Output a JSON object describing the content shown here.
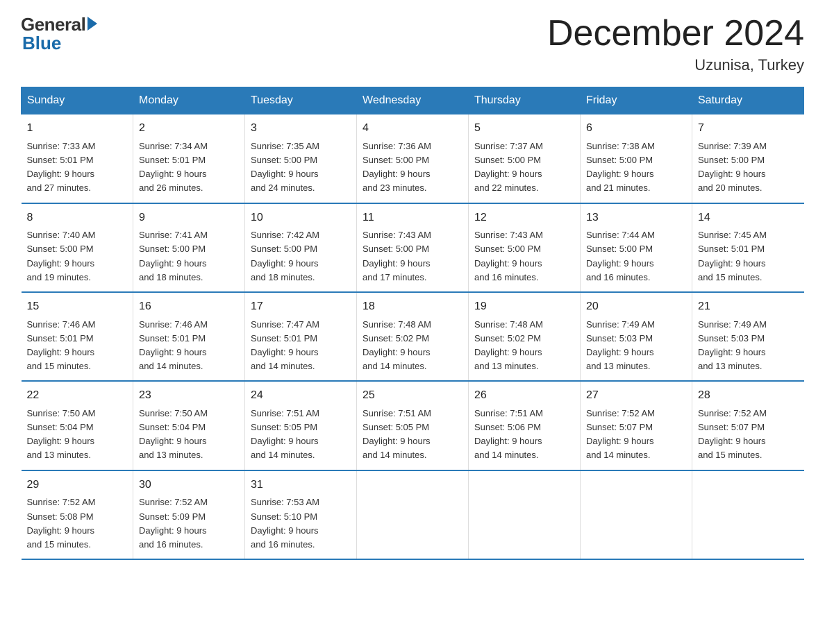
{
  "header": {
    "logo_general": "General",
    "logo_blue": "Blue",
    "title": "December 2024",
    "location": "Uzunisa, Turkey"
  },
  "days_of_week": [
    "Sunday",
    "Monday",
    "Tuesday",
    "Wednesday",
    "Thursday",
    "Friday",
    "Saturday"
  ],
  "weeks": [
    [
      {
        "day": "1",
        "info": "Sunrise: 7:33 AM\nSunset: 5:01 PM\nDaylight: 9 hours\nand 27 minutes."
      },
      {
        "day": "2",
        "info": "Sunrise: 7:34 AM\nSunset: 5:01 PM\nDaylight: 9 hours\nand 26 minutes."
      },
      {
        "day": "3",
        "info": "Sunrise: 7:35 AM\nSunset: 5:00 PM\nDaylight: 9 hours\nand 24 minutes."
      },
      {
        "day": "4",
        "info": "Sunrise: 7:36 AM\nSunset: 5:00 PM\nDaylight: 9 hours\nand 23 minutes."
      },
      {
        "day": "5",
        "info": "Sunrise: 7:37 AM\nSunset: 5:00 PM\nDaylight: 9 hours\nand 22 minutes."
      },
      {
        "day": "6",
        "info": "Sunrise: 7:38 AM\nSunset: 5:00 PM\nDaylight: 9 hours\nand 21 minutes."
      },
      {
        "day": "7",
        "info": "Sunrise: 7:39 AM\nSunset: 5:00 PM\nDaylight: 9 hours\nand 20 minutes."
      }
    ],
    [
      {
        "day": "8",
        "info": "Sunrise: 7:40 AM\nSunset: 5:00 PM\nDaylight: 9 hours\nand 19 minutes."
      },
      {
        "day": "9",
        "info": "Sunrise: 7:41 AM\nSunset: 5:00 PM\nDaylight: 9 hours\nand 18 minutes."
      },
      {
        "day": "10",
        "info": "Sunrise: 7:42 AM\nSunset: 5:00 PM\nDaylight: 9 hours\nand 18 minutes."
      },
      {
        "day": "11",
        "info": "Sunrise: 7:43 AM\nSunset: 5:00 PM\nDaylight: 9 hours\nand 17 minutes."
      },
      {
        "day": "12",
        "info": "Sunrise: 7:43 AM\nSunset: 5:00 PM\nDaylight: 9 hours\nand 16 minutes."
      },
      {
        "day": "13",
        "info": "Sunrise: 7:44 AM\nSunset: 5:00 PM\nDaylight: 9 hours\nand 16 minutes."
      },
      {
        "day": "14",
        "info": "Sunrise: 7:45 AM\nSunset: 5:01 PM\nDaylight: 9 hours\nand 15 minutes."
      }
    ],
    [
      {
        "day": "15",
        "info": "Sunrise: 7:46 AM\nSunset: 5:01 PM\nDaylight: 9 hours\nand 15 minutes."
      },
      {
        "day": "16",
        "info": "Sunrise: 7:46 AM\nSunset: 5:01 PM\nDaylight: 9 hours\nand 14 minutes."
      },
      {
        "day": "17",
        "info": "Sunrise: 7:47 AM\nSunset: 5:01 PM\nDaylight: 9 hours\nand 14 minutes."
      },
      {
        "day": "18",
        "info": "Sunrise: 7:48 AM\nSunset: 5:02 PM\nDaylight: 9 hours\nand 14 minutes."
      },
      {
        "day": "19",
        "info": "Sunrise: 7:48 AM\nSunset: 5:02 PM\nDaylight: 9 hours\nand 13 minutes."
      },
      {
        "day": "20",
        "info": "Sunrise: 7:49 AM\nSunset: 5:03 PM\nDaylight: 9 hours\nand 13 minutes."
      },
      {
        "day": "21",
        "info": "Sunrise: 7:49 AM\nSunset: 5:03 PM\nDaylight: 9 hours\nand 13 minutes."
      }
    ],
    [
      {
        "day": "22",
        "info": "Sunrise: 7:50 AM\nSunset: 5:04 PM\nDaylight: 9 hours\nand 13 minutes."
      },
      {
        "day": "23",
        "info": "Sunrise: 7:50 AM\nSunset: 5:04 PM\nDaylight: 9 hours\nand 13 minutes."
      },
      {
        "day": "24",
        "info": "Sunrise: 7:51 AM\nSunset: 5:05 PM\nDaylight: 9 hours\nand 14 minutes."
      },
      {
        "day": "25",
        "info": "Sunrise: 7:51 AM\nSunset: 5:05 PM\nDaylight: 9 hours\nand 14 minutes."
      },
      {
        "day": "26",
        "info": "Sunrise: 7:51 AM\nSunset: 5:06 PM\nDaylight: 9 hours\nand 14 minutes."
      },
      {
        "day": "27",
        "info": "Sunrise: 7:52 AM\nSunset: 5:07 PM\nDaylight: 9 hours\nand 14 minutes."
      },
      {
        "day": "28",
        "info": "Sunrise: 7:52 AM\nSunset: 5:07 PM\nDaylight: 9 hours\nand 15 minutes."
      }
    ],
    [
      {
        "day": "29",
        "info": "Sunrise: 7:52 AM\nSunset: 5:08 PM\nDaylight: 9 hours\nand 15 minutes."
      },
      {
        "day": "30",
        "info": "Sunrise: 7:52 AM\nSunset: 5:09 PM\nDaylight: 9 hours\nand 16 minutes."
      },
      {
        "day": "31",
        "info": "Sunrise: 7:53 AM\nSunset: 5:10 PM\nDaylight: 9 hours\nand 16 minutes."
      },
      {
        "day": "",
        "info": ""
      },
      {
        "day": "",
        "info": ""
      },
      {
        "day": "",
        "info": ""
      },
      {
        "day": "",
        "info": ""
      }
    ]
  ]
}
